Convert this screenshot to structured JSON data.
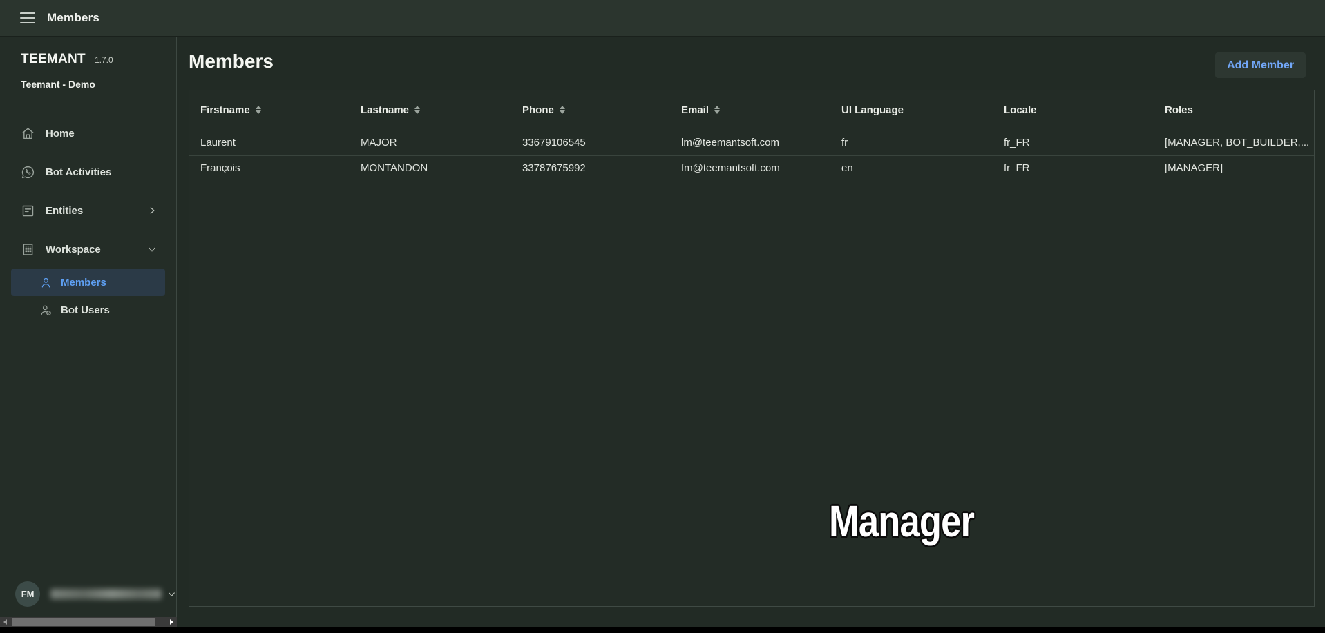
{
  "topbar": {
    "title": "Members"
  },
  "sidebar": {
    "brand": "TEEMANT",
    "version": "1.7.0",
    "workspace": "Teemant - Demo",
    "items": [
      {
        "label": "Home",
        "icon": "home"
      },
      {
        "label": "Bot Activities",
        "icon": "chat-bubble"
      },
      {
        "label": "Entities",
        "icon": "document-list",
        "chevron": "right"
      },
      {
        "label": "Workspace",
        "icon": "building",
        "chevron": "down"
      }
    ],
    "subitems": [
      {
        "label": "Members",
        "icon": "person",
        "selected": true
      },
      {
        "label": "Bot Users",
        "icon": "person-check",
        "selected": false
      }
    ],
    "user_initials": "FM"
  },
  "main": {
    "title": "Members",
    "add_member_label": "Add Member",
    "overlay_text": "Manager",
    "table": {
      "columns": [
        {
          "label": "Firstname",
          "sortable": true
        },
        {
          "label": "Lastname",
          "sortable": true
        },
        {
          "label": "Phone",
          "sortable": true
        },
        {
          "label": "Email",
          "sortable": true
        },
        {
          "label": "UI Language",
          "sortable": false
        },
        {
          "label": "Locale",
          "sortable": false
        },
        {
          "label": "Roles",
          "sortable": false
        }
      ],
      "rows": [
        {
          "firstname": "Laurent",
          "lastname": "MAJOR",
          "phone": "33679106545",
          "email": "lm@teemantsoft.com",
          "ui_language": "fr",
          "locale": "fr_FR",
          "roles": "[MANAGER, BOT_BUILDER,..."
        },
        {
          "firstname": "François",
          "lastname": "MONTANDON",
          "phone": "33787675992",
          "email": "fm@teemantsoft.com",
          "ui_language": "en",
          "locale": "fr_FR",
          "roles": "[MANAGER]"
        }
      ]
    }
  },
  "colors": {
    "topbar_bg": "#2b352e",
    "sidebar_bg": "#242d27",
    "main_bg": "#222b25",
    "card_border": "#3f4a44",
    "row_divider": "#39443d",
    "selected_item_bg": "#2b3a47",
    "accent_blue": "#5e9ff2",
    "button_blue": "#72a7f7"
  }
}
